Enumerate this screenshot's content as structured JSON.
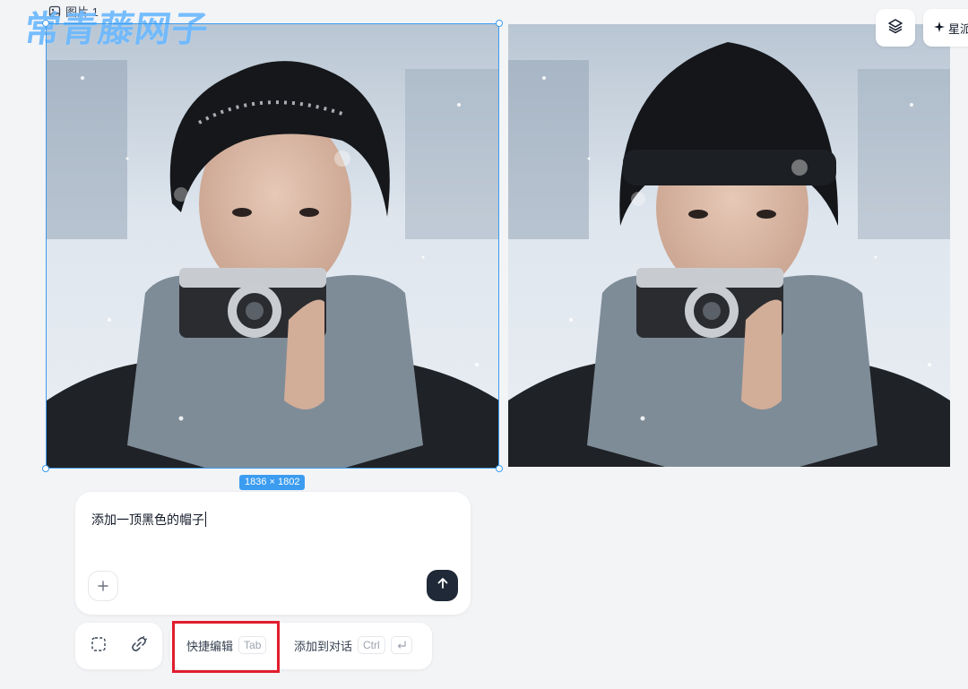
{
  "header": {
    "image_label": "图片 1",
    "image_icon": "image-icon"
  },
  "watermark": {
    "text": "常青藤网子"
  },
  "canvas": {
    "selected_image_dimensions": "1836 × 1802",
    "selection_color": "#3b9cf0"
  },
  "toolbar": {
    "layers_icon": "layers-icon",
    "star_label": "星派",
    "star_icon": "sparkle-icon"
  },
  "prompt": {
    "text": "添加一顶黑色的帽子",
    "add_icon": "plus-icon",
    "send_icon": "arrow-up-icon"
  },
  "tools": {
    "select_icon": "selection-icon",
    "link_icon": "link-icon"
  },
  "actions": {
    "quick_edit_label": "快捷编辑",
    "quick_edit_key": "Tab",
    "add_to_chat_label": "添加到对话",
    "add_to_chat_key": "Ctrl",
    "add_to_chat_icon": "enter-icon"
  },
  "highlight": {
    "color": "#e11d2e"
  }
}
